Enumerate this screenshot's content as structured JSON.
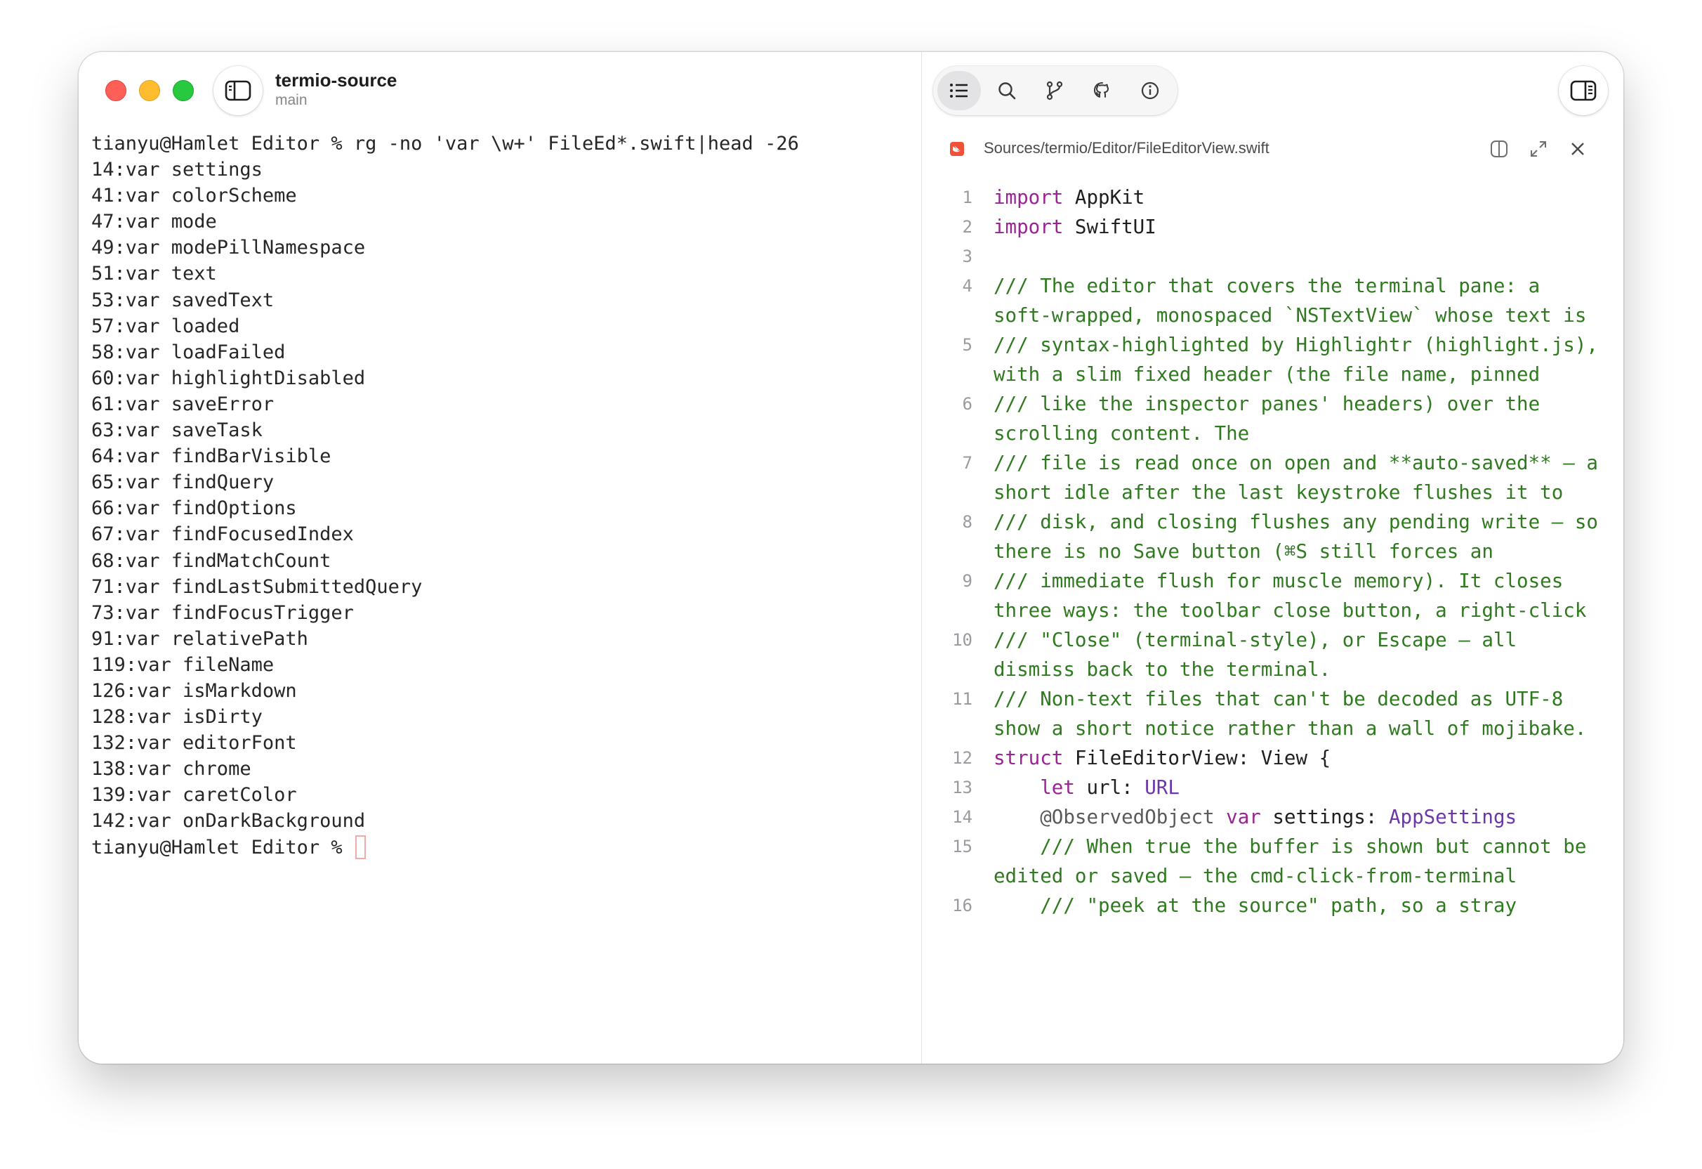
{
  "window": {
    "title": "termio-source",
    "subtitle": "main"
  },
  "terminal": {
    "lines": [
      "tianyu@Hamlet Editor % rg -no 'var \\w+' FileEd*.swift|head -26",
      "14:var settings",
      "41:var colorScheme",
      "47:var mode",
      "49:var modePillNamespace",
      "51:var text",
      "53:var savedText",
      "57:var loaded",
      "58:var loadFailed",
      "60:var highlightDisabled",
      "61:var saveError",
      "63:var saveTask",
      "64:var findBarVisible",
      "65:var findQuery",
      "66:var findOptions",
      "67:var findFocusedIndex",
      "68:var findMatchCount",
      "71:var findLastSubmittedQuery",
      "73:var findFocusTrigger",
      "91:var relativePath",
      "119:var fileName",
      "126:var isMarkdown",
      "128:var isDirty",
      "132:var editorFont",
      "138:var chrome",
      "139:var caretColor",
      "142:var onDarkBackground"
    ],
    "prompt": "tianyu@Hamlet Editor % "
  },
  "toolbar": {
    "buttons": [
      {
        "icon": "list-icon"
      },
      {
        "icon": "search-icon"
      },
      {
        "icon": "branch-icon"
      },
      {
        "icon": "github-icon"
      },
      {
        "icon": "info-icon"
      }
    ]
  },
  "editor": {
    "file_path": "Sources/termio/Editor/FileEditorView.swift",
    "lines": [
      {
        "n": "1",
        "segs": [
          [
            "kw",
            "import"
          ],
          [
            "",
            " AppKit"
          ]
        ]
      },
      {
        "n": "2",
        "segs": [
          [
            "kw",
            "import"
          ],
          [
            "",
            " SwiftUI"
          ]
        ]
      },
      {
        "n": "3",
        "segs": [
          [
            "",
            ""
          ]
        ]
      },
      {
        "n": "4",
        "segs": [
          [
            "cm",
            "/// The editor that covers the terminal pane: a soft-wrapped, monospaced `NSTextView` whose text is"
          ]
        ]
      },
      {
        "n": "5",
        "segs": [
          [
            "cm",
            "/// syntax-highlighted by Highlightr (highlight.js), with a slim fixed header (the file name, pinned"
          ]
        ]
      },
      {
        "n": "6",
        "segs": [
          [
            "cm",
            "/// like the inspector panes' headers) over the scrolling content. The"
          ]
        ]
      },
      {
        "n": "7",
        "segs": [
          [
            "cm",
            "/// file is read once on open and **auto-saved** — a short idle after the last keystroke flushes it to"
          ]
        ]
      },
      {
        "n": "8",
        "segs": [
          [
            "cm",
            "/// disk, and closing flushes any pending write — so there is no Save button (⌘S still forces an"
          ]
        ]
      },
      {
        "n": "9",
        "segs": [
          [
            "cm",
            "/// immediate flush for muscle memory). It closes three ways: the toolbar close button, a right-click"
          ]
        ]
      },
      {
        "n": "10",
        "segs": [
          [
            "cm",
            "/// \"Close\" (terminal-style), or Escape — all dismiss back to the terminal."
          ]
        ]
      },
      {
        "n": "11",
        "segs": [
          [
            "cm",
            "/// Non-text files that can't be decoded as UTF-8 show a short notice rather than a wall of mojibake."
          ]
        ]
      },
      {
        "n": "12",
        "segs": [
          [
            "kw",
            "struct"
          ],
          [
            "",
            " FileEditorView: View {"
          ]
        ]
      },
      {
        "n": "13",
        "segs": [
          [
            "",
            "    "
          ],
          [
            "kw",
            "let"
          ],
          [
            "",
            " url: "
          ],
          [
            "type",
            "URL"
          ]
        ]
      },
      {
        "n": "14",
        "segs": [
          [
            "",
            "    "
          ],
          [
            "attr",
            "@ObservedObject"
          ],
          [
            "",
            " "
          ],
          [
            "kw",
            "var"
          ],
          [
            "",
            " settings: "
          ],
          [
            "type",
            "AppSettings"
          ]
        ]
      },
      {
        "n": "15",
        "segs": [
          [
            "",
            "    "
          ],
          [
            "cm",
            "/// When true the buffer is shown but cannot be edited or saved — the cmd-click-from-terminal"
          ]
        ]
      },
      {
        "n": "16",
        "segs": [
          [
            "",
            "    "
          ],
          [
            "cm",
            "/// \"peek at the source\" path, so a stray"
          ]
        ]
      }
    ]
  },
  "colors": {
    "keyword": "#9b2393",
    "type": "#6c36a9",
    "comment": "#2f7a1f",
    "cursor_outline": "#f3a9a9"
  }
}
